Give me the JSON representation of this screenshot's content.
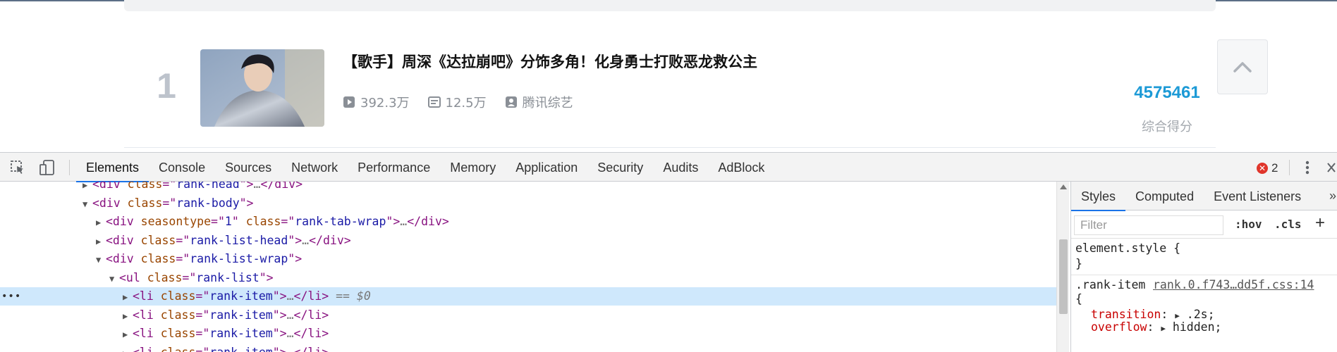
{
  "page": {
    "rank_item": {
      "rank": "1",
      "title": "【歌手】周深《达拉崩吧》分饰多角！化身勇士打败恶龙救公主",
      "plays": "392.3万",
      "danmaku": "12.5万",
      "uploader": "腾讯综艺",
      "score": "4575461",
      "score_label": "综合得分"
    }
  },
  "devtools": {
    "tabs": [
      "Elements",
      "Console",
      "Sources",
      "Network",
      "Performance",
      "Memory",
      "Application",
      "Security",
      "Audits",
      "AdBlock"
    ],
    "active_tab": "Elements",
    "error_count": "2",
    "tree": [
      {
        "indent": 0,
        "arrow": "▶",
        "parts": [
          [
            "tag",
            "<div "
          ],
          [
            "attr",
            "class"
          ],
          [
            "tag",
            "=\""
          ],
          [
            "val",
            "rank-head"
          ],
          [
            "tag",
            "\">"
          ],
          [
            "gray",
            "…"
          ],
          [
            "tag",
            "</div>"
          ]
        ]
      },
      {
        "indent": 0,
        "arrow": "▼",
        "parts": [
          [
            "tag",
            "<div "
          ],
          [
            "attr",
            "class"
          ],
          [
            "tag",
            "=\""
          ],
          [
            "val",
            "rank-body"
          ],
          [
            "tag",
            "\">"
          ]
        ]
      },
      {
        "indent": 1,
        "arrow": "▶",
        "parts": [
          [
            "tag",
            "<div "
          ],
          [
            "attr",
            "seasontype"
          ],
          [
            "tag",
            "=\""
          ],
          [
            "val",
            "1"
          ],
          [
            "tag",
            "\" "
          ],
          [
            "attr",
            "class"
          ],
          [
            "tag",
            "=\""
          ],
          [
            "val",
            "rank-tab-wrap"
          ],
          [
            "tag",
            "\">"
          ],
          [
            "gray",
            "…"
          ],
          [
            "tag",
            "</div>"
          ]
        ]
      },
      {
        "indent": 1,
        "arrow": "▶",
        "parts": [
          [
            "tag",
            "<div "
          ],
          [
            "attr",
            "class"
          ],
          [
            "tag",
            "=\""
          ],
          [
            "val",
            "rank-list-head"
          ],
          [
            "tag",
            "\">"
          ],
          [
            "gray",
            "…"
          ],
          [
            "tag",
            "</div>"
          ]
        ]
      },
      {
        "indent": 1,
        "arrow": "▼",
        "parts": [
          [
            "tag",
            "<div "
          ],
          [
            "attr",
            "class"
          ],
          [
            "tag",
            "=\""
          ],
          [
            "val",
            "rank-list-wrap"
          ],
          [
            "tag",
            "\">"
          ]
        ]
      },
      {
        "indent": 2,
        "arrow": "▼",
        "parts": [
          [
            "tag",
            "<ul "
          ],
          [
            "attr",
            "class"
          ],
          [
            "tag",
            "=\""
          ],
          [
            "val",
            "rank-list"
          ],
          [
            "tag",
            "\">"
          ]
        ]
      },
      {
        "indent": 3,
        "arrow": "▶",
        "selected": true,
        "parts": [
          [
            "tag",
            "<li "
          ],
          [
            "attr",
            "class"
          ],
          [
            "tag",
            "=\""
          ],
          [
            "val",
            "rank-item"
          ],
          [
            "tag",
            "\">"
          ],
          [
            "gray",
            "…"
          ],
          [
            "tag",
            "</li>"
          ],
          [
            "dollar",
            " == $0"
          ]
        ]
      },
      {
        "indent": 3,
        "arrow": "▶",
        "parts": [
          [
            "tag",
            "<li "
          ],
          [
            "attr",
            "class"
          ],
          [
            "tag",
            "=\""
          ],
          [
            "val",
            "rank-item"
          ],
          [
            "tag",
            "\">"
          ],
          [
            "gray",
            "…"
          ],
          [
            "tag",
            "</li>"
          ]
        ]
      },
      {
        "indent": 3,
        "arrow": "▶",
        "parts": [
          [
            "tag",
            "<li "
          ],
          [
            "attr",
            "class"
          ],
          [
            "tag",
            "=\""
          ],
          [
            "val",
            "rank-item"
          ],
          [
            "tag",
            "\">"
          ],
          [
            "gray",
            "…"
          ],
          [
            "tag",
            "</li>"
          ]
        ]
      },
      {
        "indent": 3,
        "arrow": "▶",
        "parts": [
          [
            "tag",
            "<li "
          ],
          [
            "attr",
            "class"
          ],
          [
            "tag",
            "=\""
          ],
          [
            "val",
            "rank-item"
          ],
          [
            "tag",
            "\">"
          ],
          [
            "gray",
            "…"
          ],
          [
            "tag",
            "</li>"
          ]
        ]
      }
    ],
    "styles": {
      "tabs": [
        "Styles",
        "Computed",
        "Event Listeners"
      ],
      "active_tab": "Styles",
      "more": "»",
      "filter_placeholder": "Filter",
      "hov": ":hov",
      "cls": ".cls",
      "plus": "+",
      "element_style_open": "element.style {",
      "element_style_close": "}",
      "rule_selector": ".rank-item",
      "rule_source": "rank.0.f743…dd5f.css:14",
      "rule_open": "{",
      "declarations": [
        {
          "name": "transition",
          "value": ".2s;"
        },
        {
          "name": "overflow",
          "value": "hidden;"
        }
      ]
    }
  },
  "colors": {
    "score": "#1c9ad6",
    "selected_row": "#cfe8fc",
    "active_tab_underline": "#1a73e8",
    "error": "#e0352b"
  }
}
